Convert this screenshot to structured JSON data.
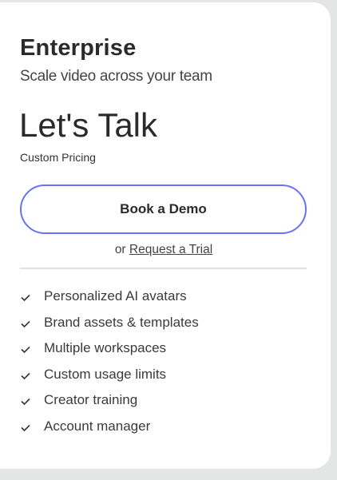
{
  "plan": {
    "name": "Enterprise",
    "tagline": "Scale video across your team",
    "price": "Let's Talk",
    "price_note": "Custom Pricing",
    "cta_label": "Book a Demo",
    "alt_prefix": "or",
    "alt_link": "Request a Trial",
    "features": [
      "Personalized AI avatars",
      "Brand assets & templates",
      "Multiple workspaces",
      "Custom usage limits",
      "Creator training",
      "Account manager"
    ]
  },
  "colors": {
    "accent": "#6673f2",
    "background": "#e4e5e5"
  }
}
